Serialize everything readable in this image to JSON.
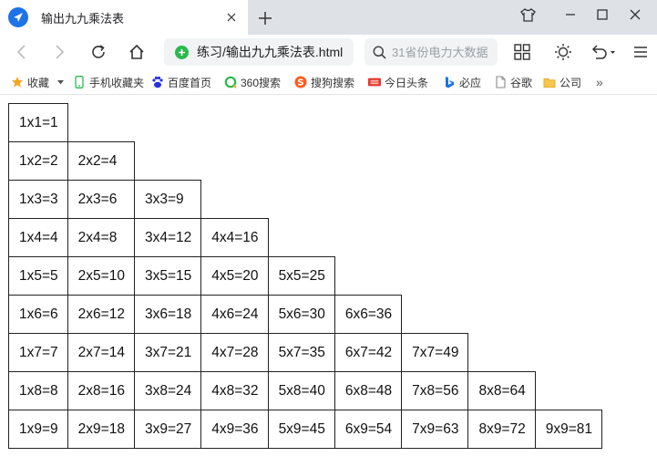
{
  "tab": {
    "title": "输出九九乘法表"
  },
  "toolbar": {
    "address": "练习/输出九九乘法表.html",
    "search_placeholder": "31省份电力大数据"
  },
  "bookmarks": [
    {
      "label": "收藏",
      "icon": "star-icon"
    },
    {
      "label": "手机收藏夹",
      "icon": "phone-icon"
    },
    {
      "label": "百度首页",
      "icon": "baidu-paw-icon"
    },
    {
      "label": "360搜索",
      "icon": "360-search-icon"
    },
    {
      "label": "搜狗搜索",
      "icon": "sogou-icon"
    },
    {
      "label": "今日头条",
      "icon": "toutiao-icon"
    },
    {
      "label": "必应",
      "icon": "bing-icon"
    },
    {
      "label": "谷歌",
      "icon": "page-icon"
    },
    {
      "label": "公司",
      "icon": "folder-icon"
    }
  ],
  "bookmarks_more": "»",
  "table": {
    "rows": [
      [
        "1x1=1"
      ],
      [
        "1x2=2",
        "2x2=4"
      ],
      [
        "1x3=3",
        "2x3=6",
        "3x3=9"
      ],
      [
        "1x4=4",
        "2x4=8",
        "3x4=12",
        "4x4=16"
      ],
      [
        "1x5=5",
        "2x5=10",
        "3x5=15",
        "4x5=20",
        "5x5=25"
      ],
      [
        "1x6=6",
        "2x6=12",
        "3x6=18",
        "4x6=24",
        "5x6=30",
        "6x6=36"
      ],
      [
        "1x7=7",
        "2x7=14",
        "3x7=21",
        "4x7=28",
        "5x7=35",
        "6x7=42",
        "7x7=49"
      ],
      [
        "1x8=8",
        "2x8=16",
        "3x8=24",
        "4x8=32",
        "5x8=40",
        "6x8=48",
        "7x8=56",
        "8x8=64"
      ],
      [
        "1x9=9",
        "2x9=18",
        "3x9=27",
        "4x9=36",
        "5x9=45",
        "6x9=54",
        "7x9=63",
        "8x9=72",
        "9x9=81"
      ]
    ]
  }
}
